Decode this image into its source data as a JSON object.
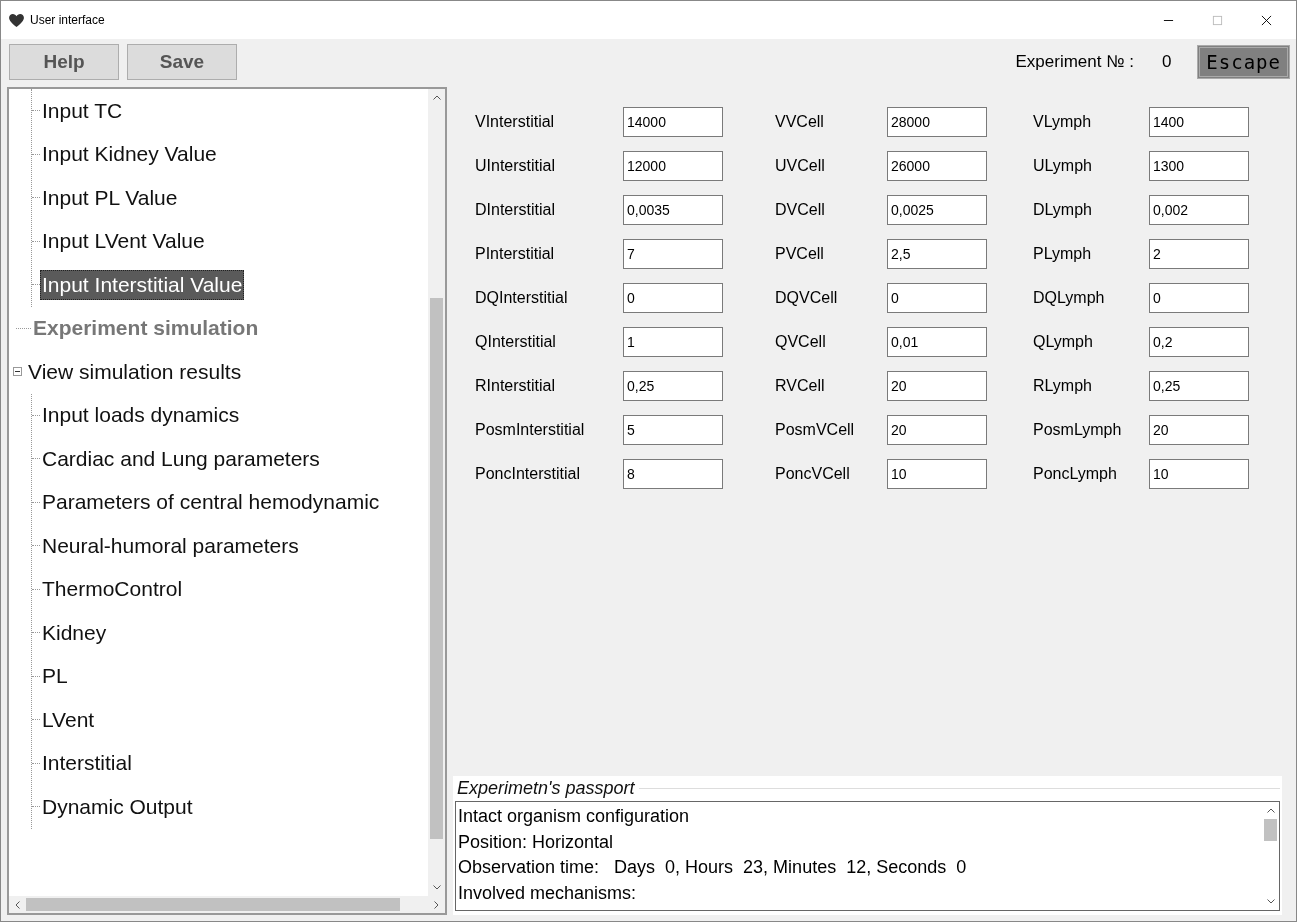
{
  "window": {
    "title": "User interface"
  },
  "toolbar": {
    "buttons": [
      "Help",
      "Save"
    ],
    "experiment_label": "Experiment № :",
    "experiment_number": "0",
    "escape_button": "Escape"
  },
  "tree": {
    "scrolled_group_children": [
      {
        "label": "Input TC",
        "selected": false
      },
      {
        "label": "Input Kidney Value",
        "selected": false
      },
      {
        "label": "Input PL Value",
        "selected": false
      },
      {
        "label": "Input LVent Value",
        "selected": false
      },
      {
        "label": "Input Interstitial Value",
        "selected": true
      }
    ],
    "nodes": [
      {
        "label": "Experiment simulation",
        "disabled": true,
        "selected": false
      },
      {
        "label": "View simulation results",
        "disabled": false,
        "selected": false,
        "expanded": true,
        "children": [
          {
            "label": "Input loads dynamics",
            "selected": false
          },
          {
            "label": "Cardiac and Lung parameters",
            "selected": false
          },
          {
            "label": "Parameters of central hemodynamic",
            "selected": false
          },
          {
            "label": "Neural-humoral parameters",
            "selected": false
          },
          {
            "label": "ThermoControl",
            "selected": false
          },
          {
            "label": "Kidney",
            "selected": false
          },
          {
            "label": "PL",
            "selected": false
          },
          {
            "label": "LVent",
            "selected": false
          },
          {
            "label": "Interstitial",
            "selected": false
          },
          {
            "label": "Dynamic Output",
            "selected": false
          }
        ]
      }
    ]
  },
  "parameters": [
    [
      {
        "label": "VInterstitial",
        "value": "14000"
      },
      {
        "label": "VVCell",
        "value": "28000"
      },
      {
        "label": "VLymph",
        "value": "1400"
      }
    ],
    [
      {
        "label": "UInterstitial",
        "value": "12000"
      },
      {
        "label": "UVCell",
        "value": "26000"
      },
      {
        "label": "ULymph",
        "value": "1300"
      }
    ],
    [
      {
        "label": "DInterstitial",
        "value": "0,0035"
      },
      {
        "label": "DVCell",
        "value": "0,0025"
      },
      {
        "label": "DLymph",
        "value": "0,002"
      }
    ],
    [
      {
        "label": "PInterstitial",
        "value": "7"
      },
      {
        "label": "PVCell",
        "value": "2,5"
      },
      {
        "label": "PLymph",
        "value": "2"
      }
    ],
    [
      {
        "label": "DQInterstitial",
        "value": "0"
      },
      {
        "label": "DQVCell",
        "value": "0"
      },
      {
        "label": "DQLymph",
        "value": "0"
      }
    ],
    [
      {
        "label": "QInterstitial",
        "value": "1"
      },
      {
        "label": "QVCell",
        "value": "0,01"
      },
      {
        "label": "QLymph",
        "value": "0,2"
      }
    ],
    [
      {
        "label": "RInterstitial",
        "value": "0,25"
      },
      {
        "label": "RVCell",
        "value": "20"
      },
      {
        "label": "RLymph",
        "value": "0,25"
      }
    ],
    [
      {
        "label": "PosmInterstitial",
        "value": "5"
      },
      {
        "label": "PosmVCell",
        "value": "20"
      },
      {
        "label": "PosmLymph",
        "value": "20"
      }
    ],
    [
      {
        "label": "PoncInterstitial",
        "value": "8"
      },
      {
        "label": "PoncVCell",
        "value": "10"
      },
      {
        "label": "PoncLymph",
        "value": "10"
      }
    ]
  ],
  "passport": {
    "title": "Experimetn's passport",
    "lines": [
      "Intact organism configuration",
      "Position: Horizontal",
      "Observation time:   Days  0, Hours  23, Minutes  12, Seconds  0",
      "Involved mechanisms:"
    ]
  }
}
